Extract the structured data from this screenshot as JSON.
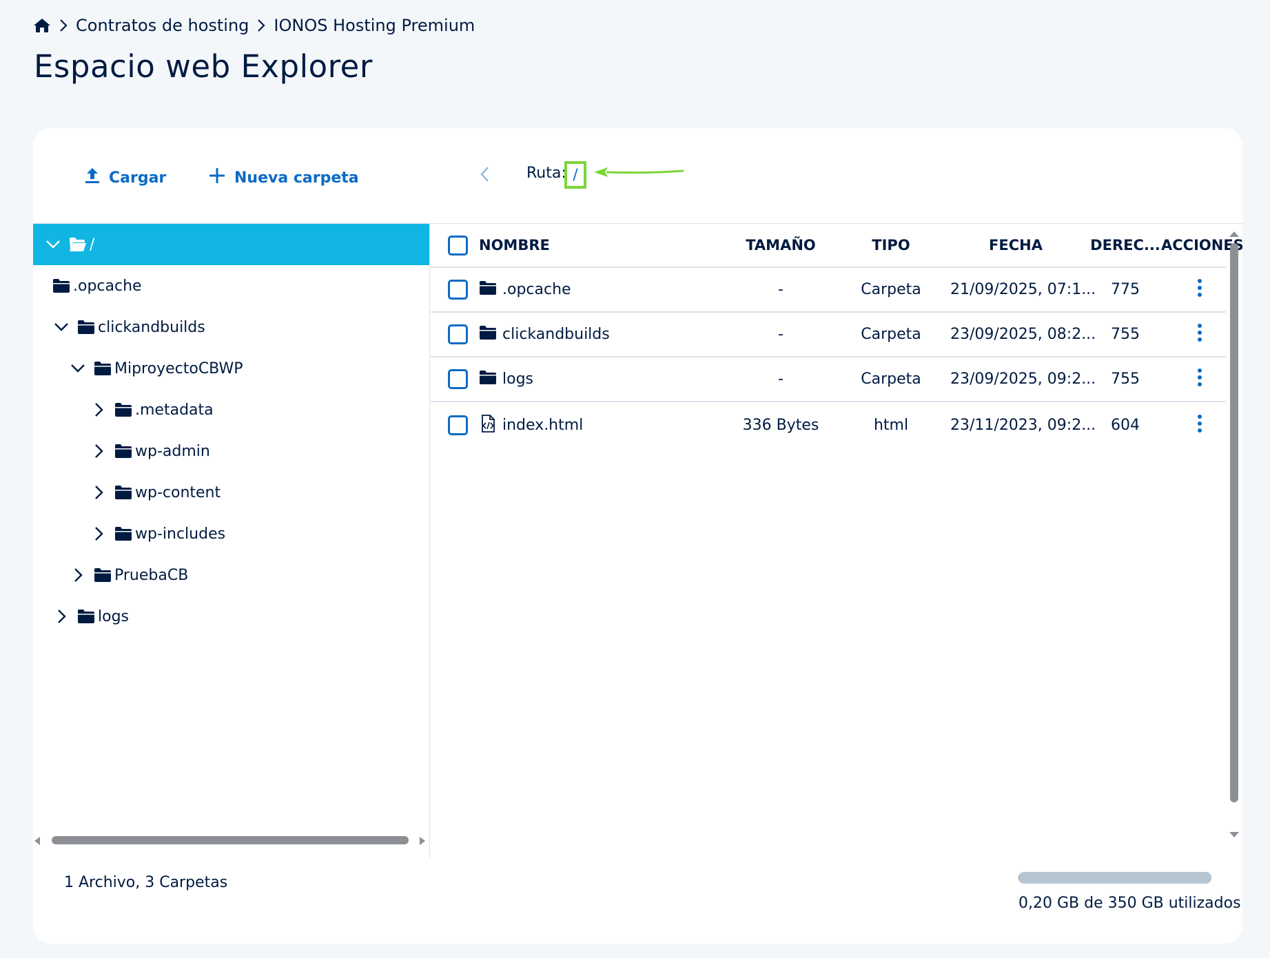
{
  "breadcrumb": {
    "items": [
      "Contratos de hosting",
      "IONOS Hosting Premium"
    ]
  },
  "page": {
    "title": "Espacio web Explorer"
  },
  "toolbar": {
    "upload_label": "Cargar",
    "new_folder_label": "Nueva carpeta",
    "path_label": "Ruta:",
    "path_value": "/"
  },
  "tree": {
    "root_label": "/",
    "opcache": ".opcache",
    "clickandbuilds": "clickandbuilds",
    "miproyecto": "MiproyectoCBWP",
    "metadata": ".metadata",
    "wp_admin": "wp-admin",
    "wp_content": "wp-content",
    "wp_includes": "wp-includes",
    "pruebacb": "PruebaCB",
    "logs": "logs"
  },
  "table": {
    "headers": {
      "name": "NOMBRE",
      "size": "TAMAÑO",
      "type": "TIPO",
      "date": "FECHA",
      "rights": "DEREC...",
      "actions": "ACCIONES"
    },
    "rows": [
      {
        "name": ".opcache",
        "size": "-",
        "type": "Carpeta",
        "date": "21/09/2025, 07:1...",
        "rights": "775",
        "icon": "folder-icon"
      },
      {
        "name": "clickandbuilds",
        "size": "-",
        "type": "Carpeta",
        "date": "23/09/2025, 08:2...",
        "rights": "755",
        "icon": "folder-icon"
      },
      {
        "name": "logs",
        "size": "-",
        "type": "Carpeta",
        "date": "23/09/2025, 09:2...",
        "rights": "755",
        "icon": "folder-icon"
      },
      {
        "name": "index.html",
        "size": "336 Bytes",
        "type": "html",
        "date": "23/11/2023, 09:2...",
        "rights": "604",
        "icon": "code-file-icon"
      }
    ]
  },
  "footer": {
    "summary": "1 Archivo, 3 Carpetas",
    "usage_text": "0,20 GB de 350 GB utilizados",
    "usage_fraction": 0.0006
  },
  "colors": {
    "accent": "#0b6bc5",
    "selected_row": "#11b5e2",
    "annotation": "#7ad63a",
    "text": "#001b41"
  }
}
